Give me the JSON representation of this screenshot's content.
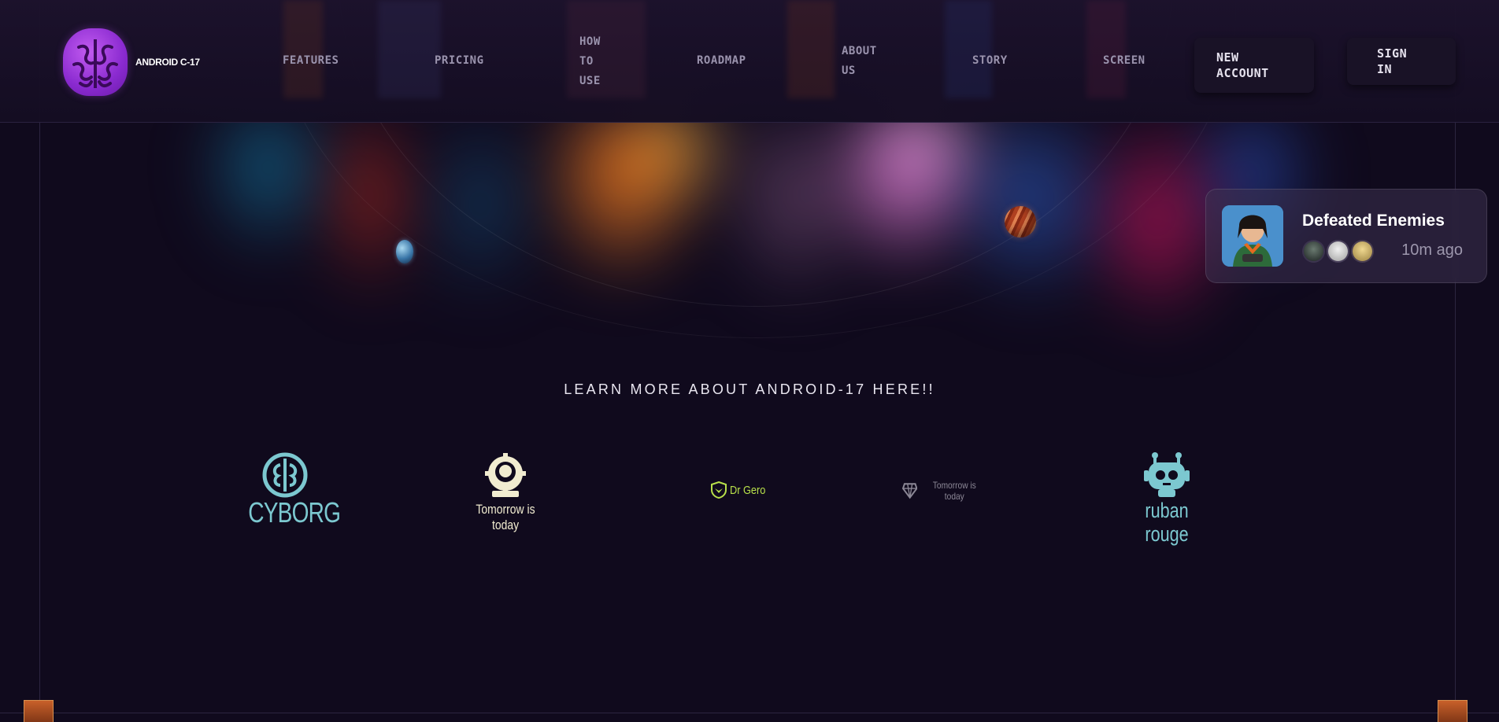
{
  "header": {
    "brand": "ANDROID C-17",
    "nav": [
      {
        "label": "FEATURES"
      },
      {
        "label": "PRICING"
      },
      {
        "label": "HOW\nTO\nUSE"
      },
      {
        "label": "ROADMAP"
      },
      {
        "label": "ABOUT\nUS"
      },
      {
        "label": "STORY"
      },
      {
        "label": "SCREEN"
      }
    ],
    "new_account": "NEW\nACCOUNT",
    "sign_in": "SIGN\nIN"
  },
  "notification": {
    "title": "Defeated Enemies",
    "time": "10m ago"
  },
  "learn_more": "LEARN MORE ABOUT ANDROID-17 HERE!!",
  "partners": [
    {
      "name": "CYBORG",
      "icon": "brain-circuit-icon",
      "color": "#7cc8d0"
    },
    {
      "name": "Tomorrow is today",
      "icon": "gear-head-icon",
      "color": "#f1ecd0"
    },
    {
      "name": "Dr Gero",
      "icon": "shield-leaf-icon",
      "color": "#b8e04a"
    },
    {
      "name": "Tomorrow is today",
      "icon": "diamond-icon",
      "color": "#8c8896"
    },
    {
      "name": "ruban rouge",
      "icon": "robot-head-icon",
      "color": "#7cc8d0"
    }
  ],
  "colors": {
    "background": "#100a1d",
    "brand_purple": "#a23de0",
    "accent_teal": "#7cc8d0"
  }
}
